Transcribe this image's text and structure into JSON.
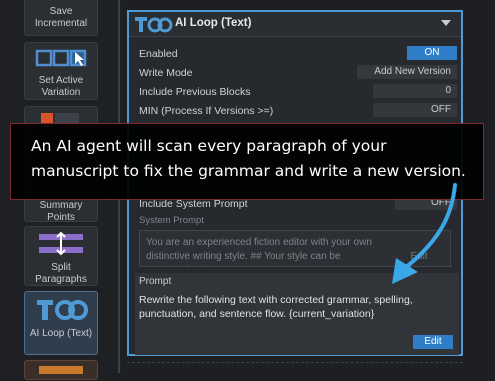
{
  "sidebar": {
    "items": [
      {
        "label": "Save Incremental"
      },
      {
        "label": "Set Active Variation"
      },
      {
        "label": "Summary Points"
      },
      {
        "label": "Split Paragraphs"
      },
      {
        "label": "AI Loop (Text)"
      }
    ]
  },
  "panel": {
    "title": "AI Loop (Text)",
    "rows": [
      {
        "label": "Enabled",
        "value": "ON"
      },
      {
        "label": "Write Mode",
        "value": "Add New Version"
      },
      {
        "label": "Include Previous Blocks",
        "value": "0"
      },
      {
        "label": "MIN (Process If Versions >=)",
        "value": "OFF"
      }
    ],
    "include_system_prompt": {
      "label": "Include System Prompt",
      "value": "OFF"
    },
    "system_prompt": {
      "label": "System Prompt",
      "text": "You are an experienced fiction editor with your own distinctive writing style.  ## Your style can be characterized as:",
      "edit_label": "Edit"
    },
    "prompt": {
      "label": "Prompt",
      "text": "Rewrite the following text with corrected grammar, spelling, punctuation, and sentence flow. {current_variation}",
      "edit_label": "Edit"
    }
  },
  "caption": {
    "text": "An AI agent will scan every paragraph of your manuscript to fix the grammar and write a new version."
  },
  "colors": {
    "accent": "#2f7ec7",
    "panel_border": "#4f9ad4",
    "arrow": "#3aa8e8",
    "caption_border": "#7a2c2c"
  }
}
